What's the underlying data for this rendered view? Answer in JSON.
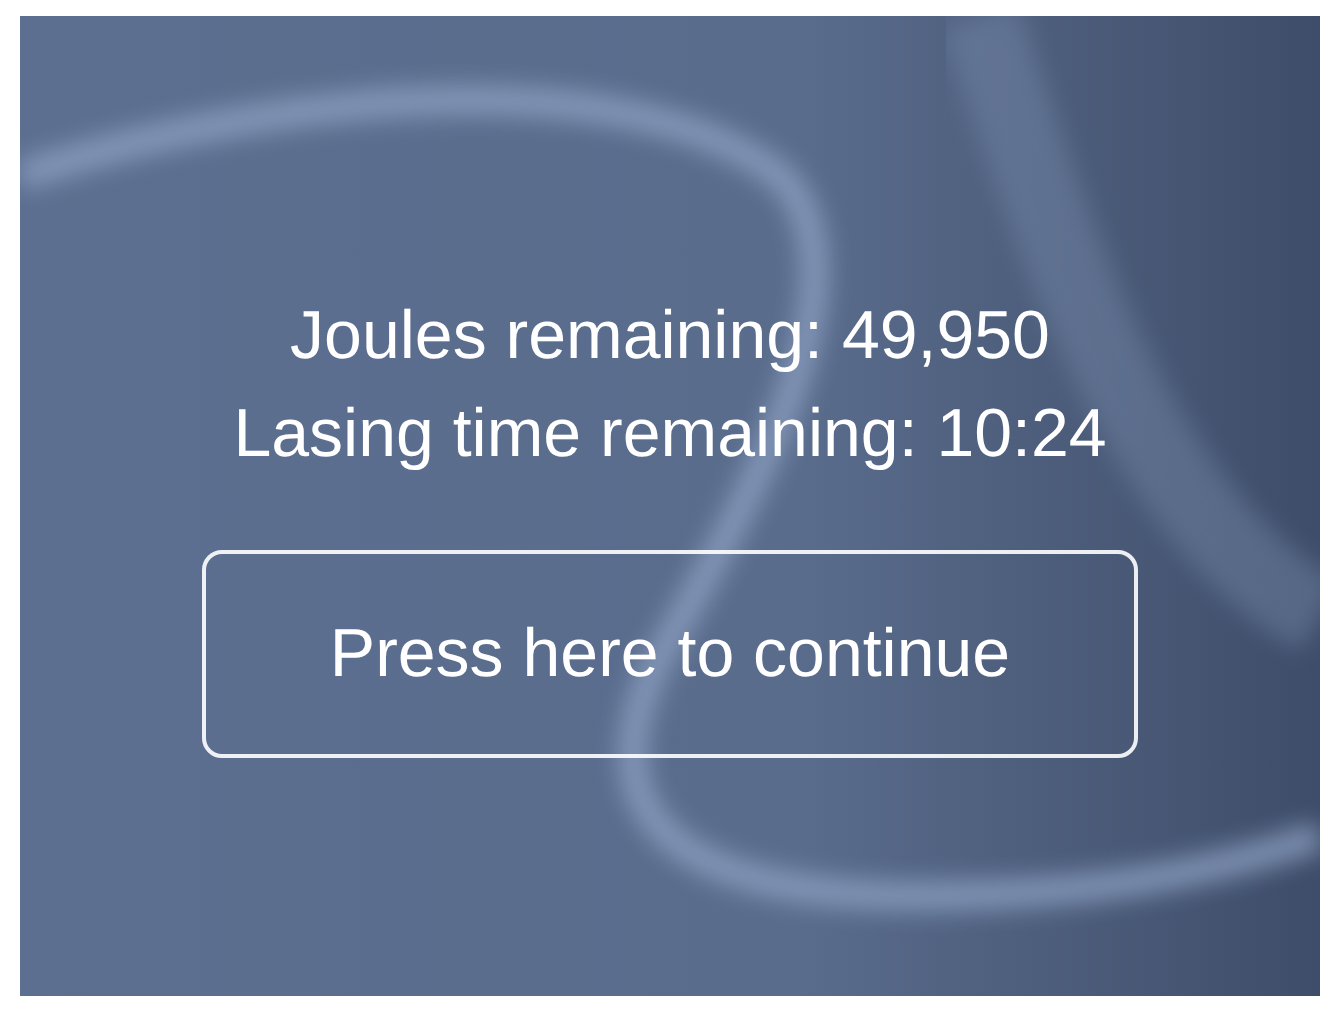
{
  "status_lines": [
    {
      "text": "Joules remaining: 49,950"
    },
    {
      "text": "Lasing time remaining: 10:24"
    }
  ],
  "continue_button": {
    "label": "Press here to continue"
  }
}
